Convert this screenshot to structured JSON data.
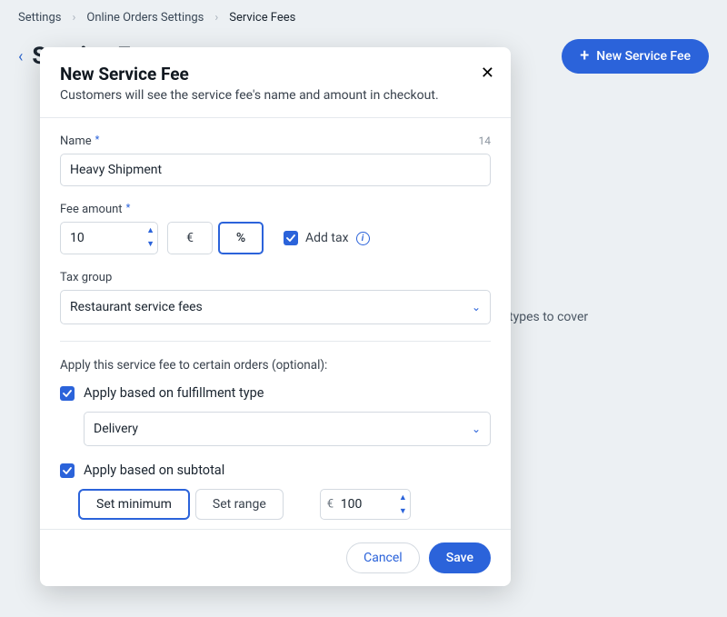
{
  "breadcrumb": {
    "a": "Settings",
    "b": "Online Orders Settings",
    "c": "Service Fees"
  },
  "bg": {
    "title": "Service Fees",
    "new_btn": "New Service Fee",
    "blurb": "types to cover"
  },
  "modal": {
    "title": "New Service Fee",
    "subtitle": "Customers will see the service fee's name and amount in checkout.",
    "name_label": "Name",
    "name_value": "Heavy Shipment",
    "name_counter": "14",
    "fee_label": "Fee amount",
    "fee_value": "10",
    "currency": "€",
    "percent": "%",
    "add_tax": "Add tax",
    "taxgroup_label": "Tax group",
    "taxgroup_value": "Restaurant service fees",
    "apply_label": "Apply this service fee to certain orders (optional):",
    "fulfillment_label": "Apply based on fulfillment type",
    "fulfillment_value": "Delivery",
    "subtotal_label": "Apply based on subtotal",
    "set_min": "Set minimum",
    "set_range": "Set range",
    "min_value": "100",
    "cancel": "Cancel",
    "save": "Save"
  }
}
